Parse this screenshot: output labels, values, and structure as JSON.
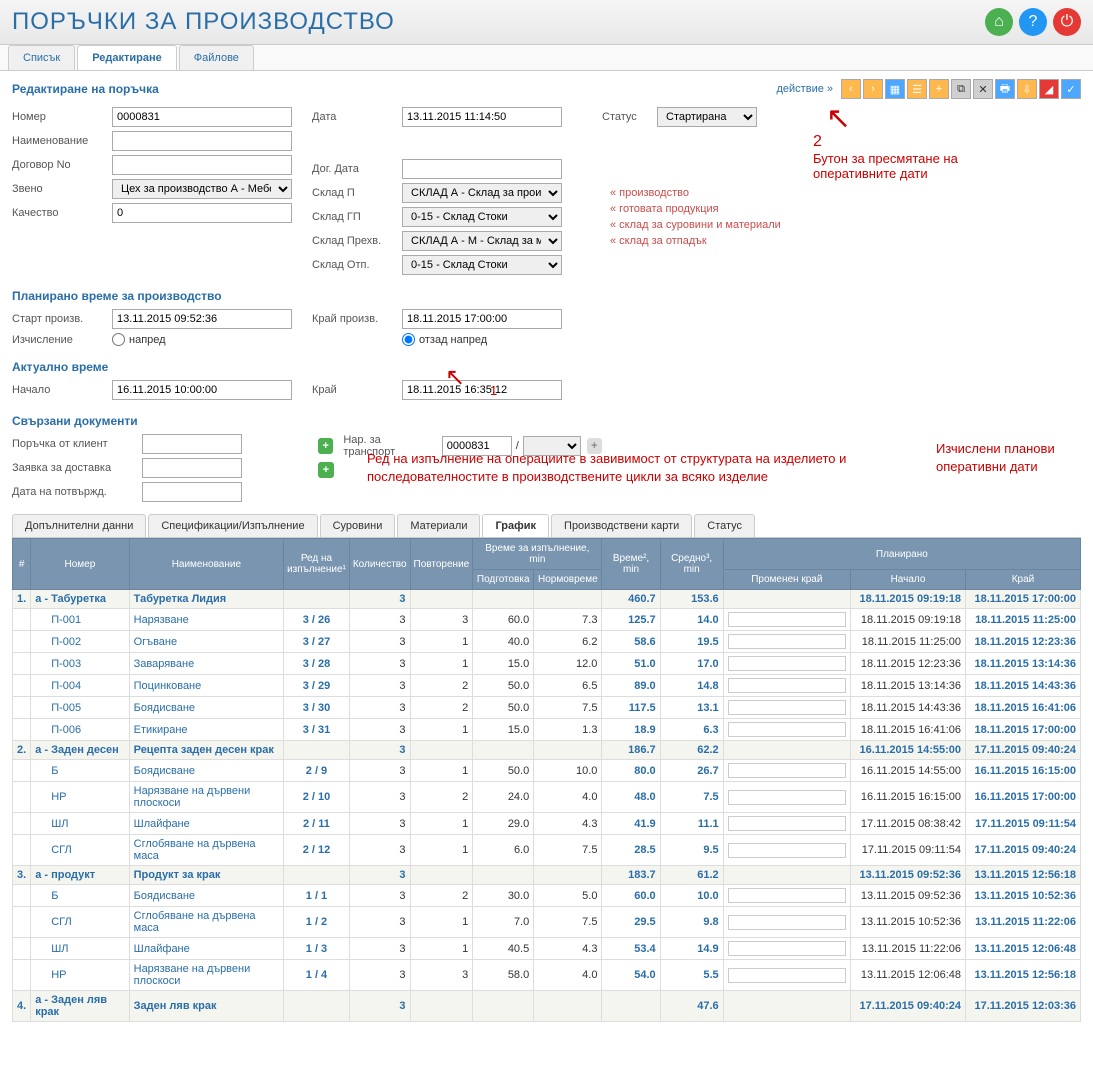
{
  "page_title": "ПОРЪЧКИ ЗА ПРОИЗВОДСТВО",
  "tabs": {
    "list": "Списък",
    "edit": "Редактиране",
    "files": "Файлове"
  },
  "section_edit": "Редактиране на поръчка",
  "action_label": "действие »",
  "fields": {
    "number_label": "Номер",
    "number": "0000831",
    "date_label": "Дата",
    "date": "13.11.2015 11:14:50",
    "status_label": "Статус",
    "status": "Стартирана",
    "name_label": "Наименование",
    "contract_label": "Договор No",
    "contract_date_label": "Дог. Дата",
    "unit_label": "Звено",
    "unit": "Цех за производство А - Мебел",
    "whp_label": "Склад П",
    "whp": "СКЛАД А - Склад за производс",
    "whp_hint": "« производство",
    "quality_label": "Качество",
    "quality": "0",
    "whgp_label": "Склад ГП",
    "whgp": "0-15 - Склад Стоки",
    "whgp_hint": "« готовата продукция",
    "whprex_label": "Склад Прехв.",
    "whprex": "СКЛАД А - М - Склад за матери",
    "whprex_hint": "« склад за суровини и материали",
    "whotp_label": "Склад Отп.",
    "whotp": "0-15 - Склад Стоки",
    "whotp_hint": "« склад за отпадък"
  },
  "planned_section": "Планирано време за производство",
  "planned": {
    "start_label": "Старт произв.",
    "start": "13.11.2015 09:52:36",
    "end_label": "Край произв.",
    "end": "18.11.2015 17:00:00",
    "calc_label": "Изчисление",
    "forward": "напред",
    "backward": "отзад напред"
  },
  "actual_section": "Актуално време",
  "actual": {
    "start_label": "Начало",
    "start": "16.11.2015 10:00:00",
    "end_label": "Край",
    "end": "18.11.2015 16:35:12"
  },
  "linked_section": "Свързани документи",
  "linked": {
    "client_order": "Поръчка от клиент",
    "delivery_req": "Заявка за доставка",
    "confirm_date": "Дата на потвържд.",
    "transport_label": "Нар. за транспорт",
    "transport_no": "0000831"
  },
  "annotations": {
    "a1": "1",
    "a2_num": "2",
    "a2": "Бутон за пресмятане на оперативните дати",
    "a3": "Ред на изпълнение на операциите в завивимост от структурата на изделието и последователностите в производствените цикли за всяко изделие",
    "a4": "Изчислени планови оперативни дати"
  },
  "inner_tabs": {
    "extra": "Допълнителни данни",
    "spec": "Спецификации/Изпълнение",
    "raw": "Суровини",
    "mat": "Материали",
    "graph": "График",
    "cards": "Производствени карти",
    "status": "Статус"
  },
  "columns": {
    "idx": "#",
    "number": "Номер",
    "name": "Наименование",
    "order": "Ред на изпълнение¹",
    "qty": "Количество",
    "repeat": "Повторение",
    "time_group": "Време за изпълнение, min",
    "prep": "Подготовка",
    "norm": "Нормовреме",
    "time2": "Време², min",
    "avg3": "Средно³, min",
    "planned_group": "Планирано",
    "changed_end": "Променен край",
    "start": "Начало",
    "end": "Край"
  },
  "rows": [
    {
      "idx": "1.",
      "num": "а - Табуретка",
      "name": "Табуретка Лидия",
      "order": "",
      "qty": "3",
      "rep": "",
      "prep": "",
      "norm": "",
      "t2": "460.7",
      "avg": "153.6",
      "ce": "",
      "start": "18.11.2015 09:19:18",
      "end": "18.11.2015 17:00:00",
      "group": true
    },
    {
      "idx": "",
      "num": "П-001",
      "name": "Нарязване",
      "order": "3 / 26",
      "qty": "3",
      "rep": "3",
      "prep": "60.0",
      "norm": "7.3",
      "t2": "125.7",
      "avg": "14.0",
      "ce": "",
      "start": "18.11.2015 09:19:18",
      "end": "18.11.2015 11:25:00"
    },
    {
      "idx": "",
      "num": "П-002",
      "name": "Огъване",
      "order": "3 / 27",
      "qty": "3",
      "rep": "1",
      "prep": "40.0",
      "norm": "6.2",
      "t2": "58.6",
      "avg": "19.5",
      "ce": "",
      "start": "18.11.2015 11:25:00",
      "end": "18.11.2015 12:23:36"
    },
    {
      "idx": "",
      "num": "П-003",
      "name": "Заваряване",
      "order": "3 / 28",
      "qty": "3",
      "rep": "1",
      "prep": "15.0",
      "norm": "12.0",
      "t2": "51.0",
      "avg": "17.0",
      "ce": "",
      "start": "18.11.2015 12:23:36",
      "end": "18.11.2015 13:14:36"
    },
    {
      "idx": "",
      "num": "П-004",
      "name": "Поцинковане",
      "order": "3 / 29",
      "qty": "3",
      "rep": "2",
      "prep": "50.0",
      "norm": "6.5",
      "t2": "89.0",
      "avg": "14.8",
      "ce": "",
      "start": "18.11.2015 13:14:36",
      "end": "18.11.2015 14:43:36"
    },
    {
      "idx": "",
      "num": "П-005",
      "name": "Боядисване",
      "order": "3 / 30",
      "qty": "3",
      "rep": "2",
      "prep": "50.0",
      "norm": "7.5",
      "t2": "117.5",
      "avg": "13.1",
      "ce": "",
      "start": "18.11.2015 14:43:36",
      "end": "18.11.2015 16:41:06"
    },
    {
      "idx": "",
      "num": "П-006",
      "name": "Етикиране",
      "order": "3 / 31",
      "qty": "3",
      "rep": "1",
      "prep": "15.0",
      "norm": "1.3",
      "t2": "18.9",
      "avg": "6.3",
      "ce": "",
      "start": "18.11.2015 16:41:06",
      "end": "18.11.2015 17:00:00"
    },
    {
      "idx": "2.",
      "num": "а - Заден десен",
      "name": "Рецепта заден десен крак",
      "order": "",
      "qty": "3",
      "rep": "",
      "prep": "",
      "norm": "",
      "t2": "186.7",
      "avg": "62.2",
      "ce": "",
      "start": "16.11.2015 14:55:00",
      "end": "17.11.2015 09:40:24",
      "group": true
    },
    {
      "idx": "",
      "num": "Б",
      "name": "Боядисване",
      "order": "2 / 9",
      "qty": "3",
      "rep": "1",
      "prep": "50.0",
      "norm": "10.0",
      "t2": "80.0",
      "avg": "26.7",
      "ce": "",
      "start": "16.11.2015 14:55:00",
      "end": "16.11.2015 16:15:00"
    },
    {
      "idx": "",
      "num": "НР",
      "name": "Нарязване на дървени плоскоси",
      "order": "2 / 10",
      "qty": "3",
      "rep": "2",
      "prep": "24.0",
      "norm": "4.0",
      "t2": "48.0",
      "avg": "7.5",
      "ce": "",
      "start": "16.11.2015 16:15:00",
      "end": "16.11.2015 17:00:00"
    },
    {
      "idx": "",
      "num": "ШЛ",
      "name": "Шлайфане",
      "order": "2 / 11",
      "qty": "3",
      "rep": "1",
      "prep": "29.0",
      "norm": "4.3",
      "t2": "41.9",
      "avg": "11.1",
      "ce": "",
      "start": "17.11.2015 08:38:42",
      "end": "17.11.2015 09:11:54"
    },
    {
      "idx": "",
      "num": "СГЛ",
      "name": "Сглобяване на дървена маса",
      "order": "2 / 12",
      "qty": "3",
      "rep": "1",
      "prep": "6.0",
      "norm": "7.5",
      "t2": "28.5",
      "avg": "9.5",
      "ce": "",
      "start": "17.11.2015 09:11:54",
      "end": "17.11.2015 09:40:24"
    },
    {
      "idx": "3.",
      "num": "а - продукт",
      "name": "Продукт за крак",
      "order": "",
      "qty": "3",
      "rep": "",
      "prep": "",
      "norm": "",
      "t2": "183.7",
      "avg": "61.2",
      "ce": "",
      "start": "13.11.2015 09:52:36",
      "end": "13.11.2015 12:56:18",
      "group": true
    },
    {
      "idx": "",
      "num": "Б",
      "name": "Боядисване",
      "order": "1 / 1",
      "qty": "3",
      "rep": "2",
      "prep": "30.0",
      "norm": "5.0",
      "t2": "60.0",
      "avg": "10.0",
      "ce": "",
      "start": "13.11.2015 09:52:36",
      "end": "13.11.2015 10:52:36"
    },
    {
      "idx": "",
      "num": "СГЛ",
      "name": "Сглобяване на дървена маса",
      "order": "1 / 2",
      "qty": "3",
      "rep": "1",
      "prep": "7.0",
      "norm": "7.5",
      "t2": "29.5",
      "avg": "9.8",
      "ce": "",
      "start": "13.11.2015 10:52:36",
      "end": "13.11.2015 11:22:06"
    },
    {
      "idx": "",
      "num": "ШЛ",
      "name": "Шлайфане",
      "order": "1 / 3",
      "qty": "3",
      "rep": "1",
      "prep": "40.5",
      "norm": "4.3",
      "t2": "53.4",
      "avg": "14.9",
      "ce": "",
      "start": "13.11.2015 11:22:06",
      "end": "13.11.2015 12:06:48"
    },
    {
      "idx": "",
      "num": "НР",
      "name": "Нарязване на дървени плоскоси",
      "order": "1 / 4",
      "qty": "3",
      "rep": "3",
      "prep": "58.0",
      "norm": "4.0",
      "t2": "54.0",
      "avg": "5.5",
      "ce": "",
      "start": "13.11.2015 12:06:48",
      "end": "13.11.2015 12:56:18"
    },
    {
      "idx": "4.",
      "num": "а - Заден ляв крак",
      "name": "Заден ляв крак",
      "order": "",
      "qty": "3",
      "rep": "",
      "prep": "",
      "norm": "",
      "t2": "",
      "avg": "47.6",
      "ce": "",
      "start": "17.11.2015 09:40:24",
      "end": "17.11.2015 12:03:36",
      "group": true
    }
  ]
}
